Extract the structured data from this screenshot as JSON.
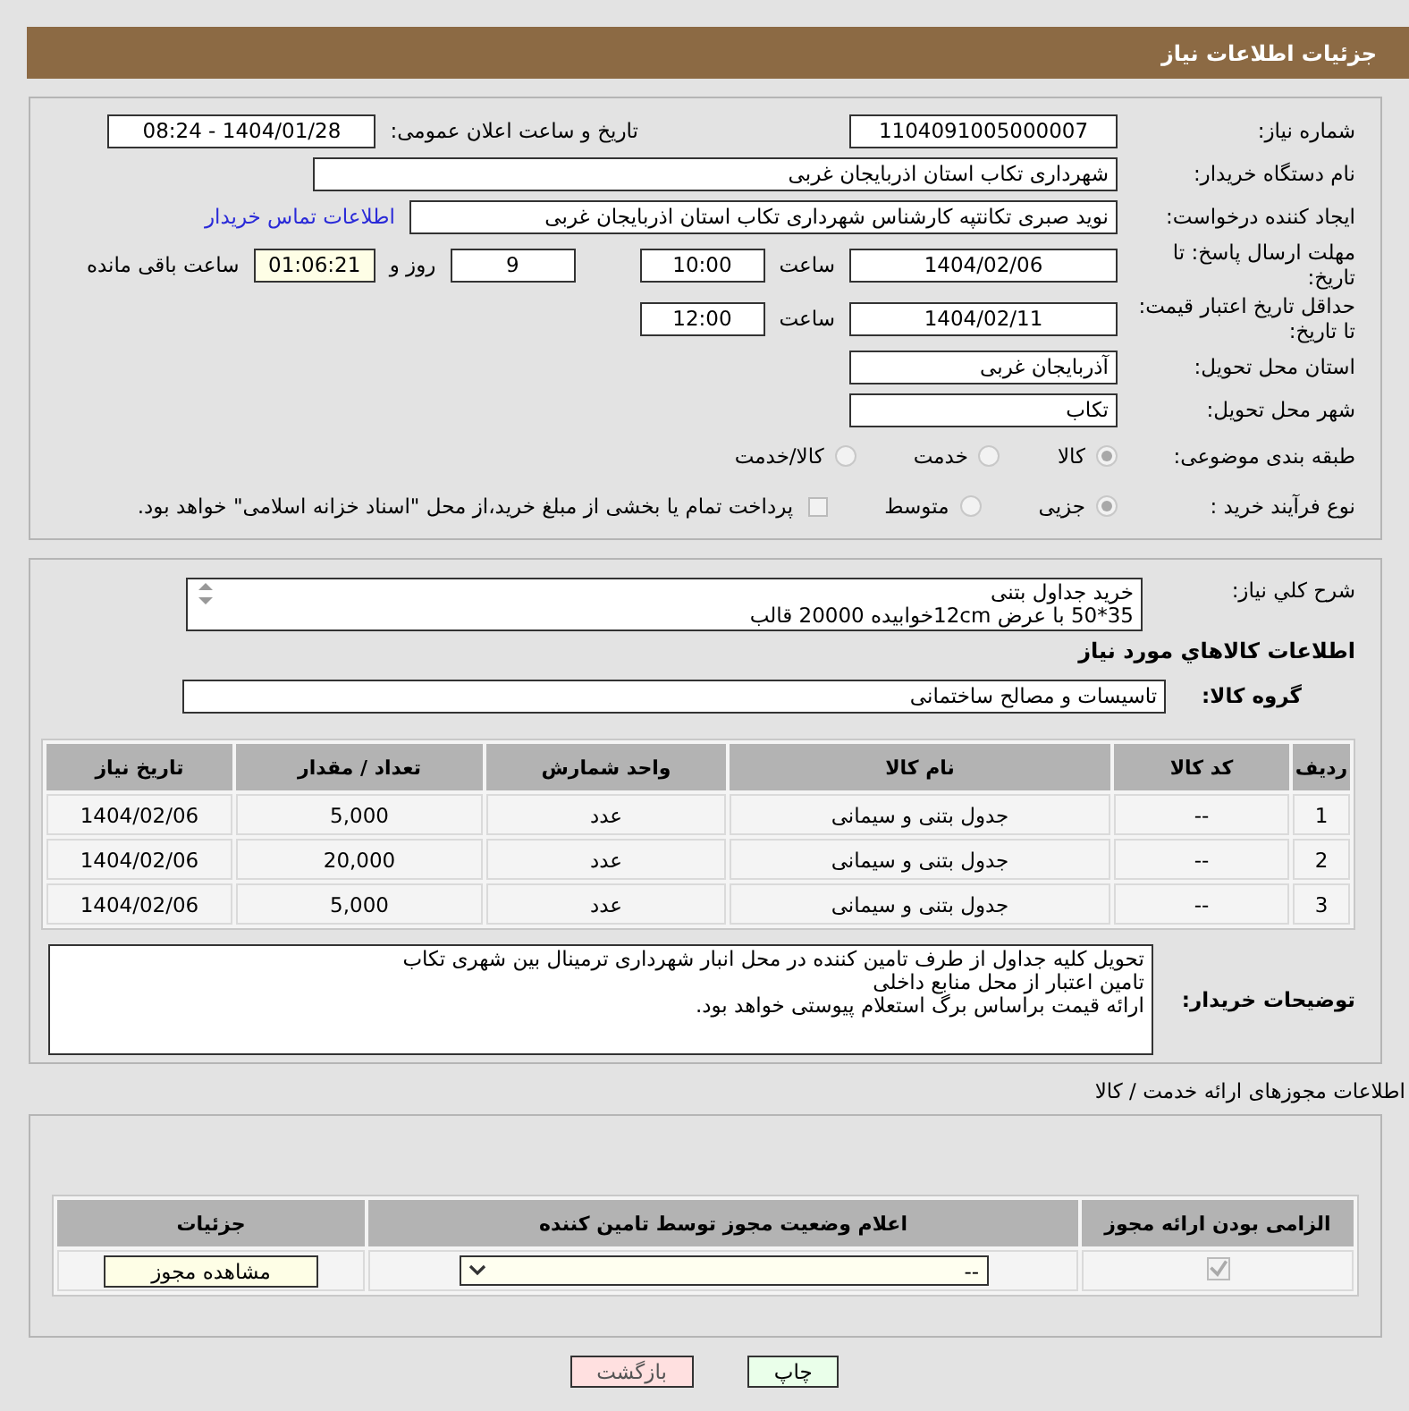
{
  "header": {
    "title": "جزئیات اطلاعات نیاز"
  },
  "need_number": {
    "label": "شماره نیاز:",
    "value": "1104091005000007"
  },
  "announce": {
    "label": "تاریخ و ساعت اعلان عمومی:",
    "value": "1404/01/28 - 08:24"
  },
  "buyer": {
    "label": "نام دستگاه خریدار:",
    "value": "شهرداری تکاب استان اذربایجان غربی"
  },
  "creator": {
    "label": "ایجاد کننده درخواست:",
    "value": "نوید صبری تکانتپه کارشناس شهرداری تکاب استان اذربایجان غربی",
    "link": "اطلاعات تماس خریدار"
  },
  "deadline": {
    "label": "مهلت ارسال پاسخ: تا تاریخ:",
    "date": "1404/02/06",
    "time_label": "ساعت",
    "time": "10:00",
    "days": "9",
    "days_label": "روز و",
    "remaining": "01:06:21",
    "remaining_label": "ساعت باقی مانده"
  },
  "validity": {
    "label": "حداقل تاریخ اعتبار قیمت: تا تاریخ:",
    "date": "1404/02/11",
    "time_label": "ساعت",
    "time": "12:00"
  },
  "province": {
    "label": "استان محل تحویل:",
    "value": "آذربایجان غربی"
  },
  "city": {
    "label": "شهر محل تحویل:",
    "value": "تکاب"
  },
  "category": {
    "label": "طبقه بندی موضوعی:",
    "options": [
      {
        "label": "کالا",
        "selected": true
      },
      {
        "label": "خدمت",
        "selected": false
      },
      {
        "label": "کالا/خدمت",
        "selected": false
      }
    ]
  },
  "process": {
    "label": "نوع فرآیند خرید :",
    "options": [
      {
        "label": "جزیی",
        "selected": true
      },
      {
        "label": "متوسط",
        "selected": false
      }
    ],
    "payment": {
      "label": "پرداخت تمام یا بخشی از مبلغ خرید،از محل \"اسناد خزانه اسلامی\" خواهد بود.",
      "checked": false
    }
  },
  "description": {
    "label": "شرح کلي نياز:",
    "lines": [
      "خرید جداول بتنی",
      "35*50 با عرض 12cmخوابیده 20000 قالب"
    ]
  },
  "goods_heading": "اطلاعات کالاهاي مورد نياز",
  "goods_group": {
    "label": "گروه کالا:",
    "value": "تاسیسات و مصالح ساختمانی"
  },
  "goods_table": {
    "columns": [
      "ردیف",
      "کد کالا",
      "نام کالا",
      "واحد شمارش",
      "تعداد / مقدار",
      "تاریخ نیاز"
    ],
    "rows": [
      [
        "1",
        "--",
        "جدول بتنی و سیمانی",
        "عدد",
        "5,000",
        "1404/02/06"
      ],
      [
        "2",
        "--",
        "جدول بتنی و سیمانی",
        "عدد",
        "20,000",
        "1404/02/06"
      ],
      [
        "3",
        "--",
        "جدول بتنی و سیمانی",
        "عدد",
        "5,000",
        "1404/02/06"
      ]
    ]
  },
  "notes": {
    "label": "توضیحات خریدار:",
    "lines": [
      "تحویل کلیه جداول از طرف تامین کننده در محل انبار شهرداری ترمینال بین شهری تکاب",
      "تامین اعتبار از محل منابع داخلی",
      "ارائه قیمت براساس برگ استعلام پیوستی خواهد بود."
    ]
  },
  "permits_heading": "اطلاعات مجوزهای ارائه خدمت / کالا",
  "permits_table": {
    "columns": [
      "الزامی بودن ارائه مجوز",
      "اعلام وضعیت مجوز توسط تامین کننده",
      "جزئیات"
    ],
    "rows": [
      {
        "required": true,
        "status": "--",
        "details_button": "مشاهده مجوز"
      }
    ]
  },
  "buttons": [
    {
      "label": "چاپ",
      "kind": "print"
    },
    {
      "label": "بازگشت",
      "kind": "back"
    }
  ]
}
